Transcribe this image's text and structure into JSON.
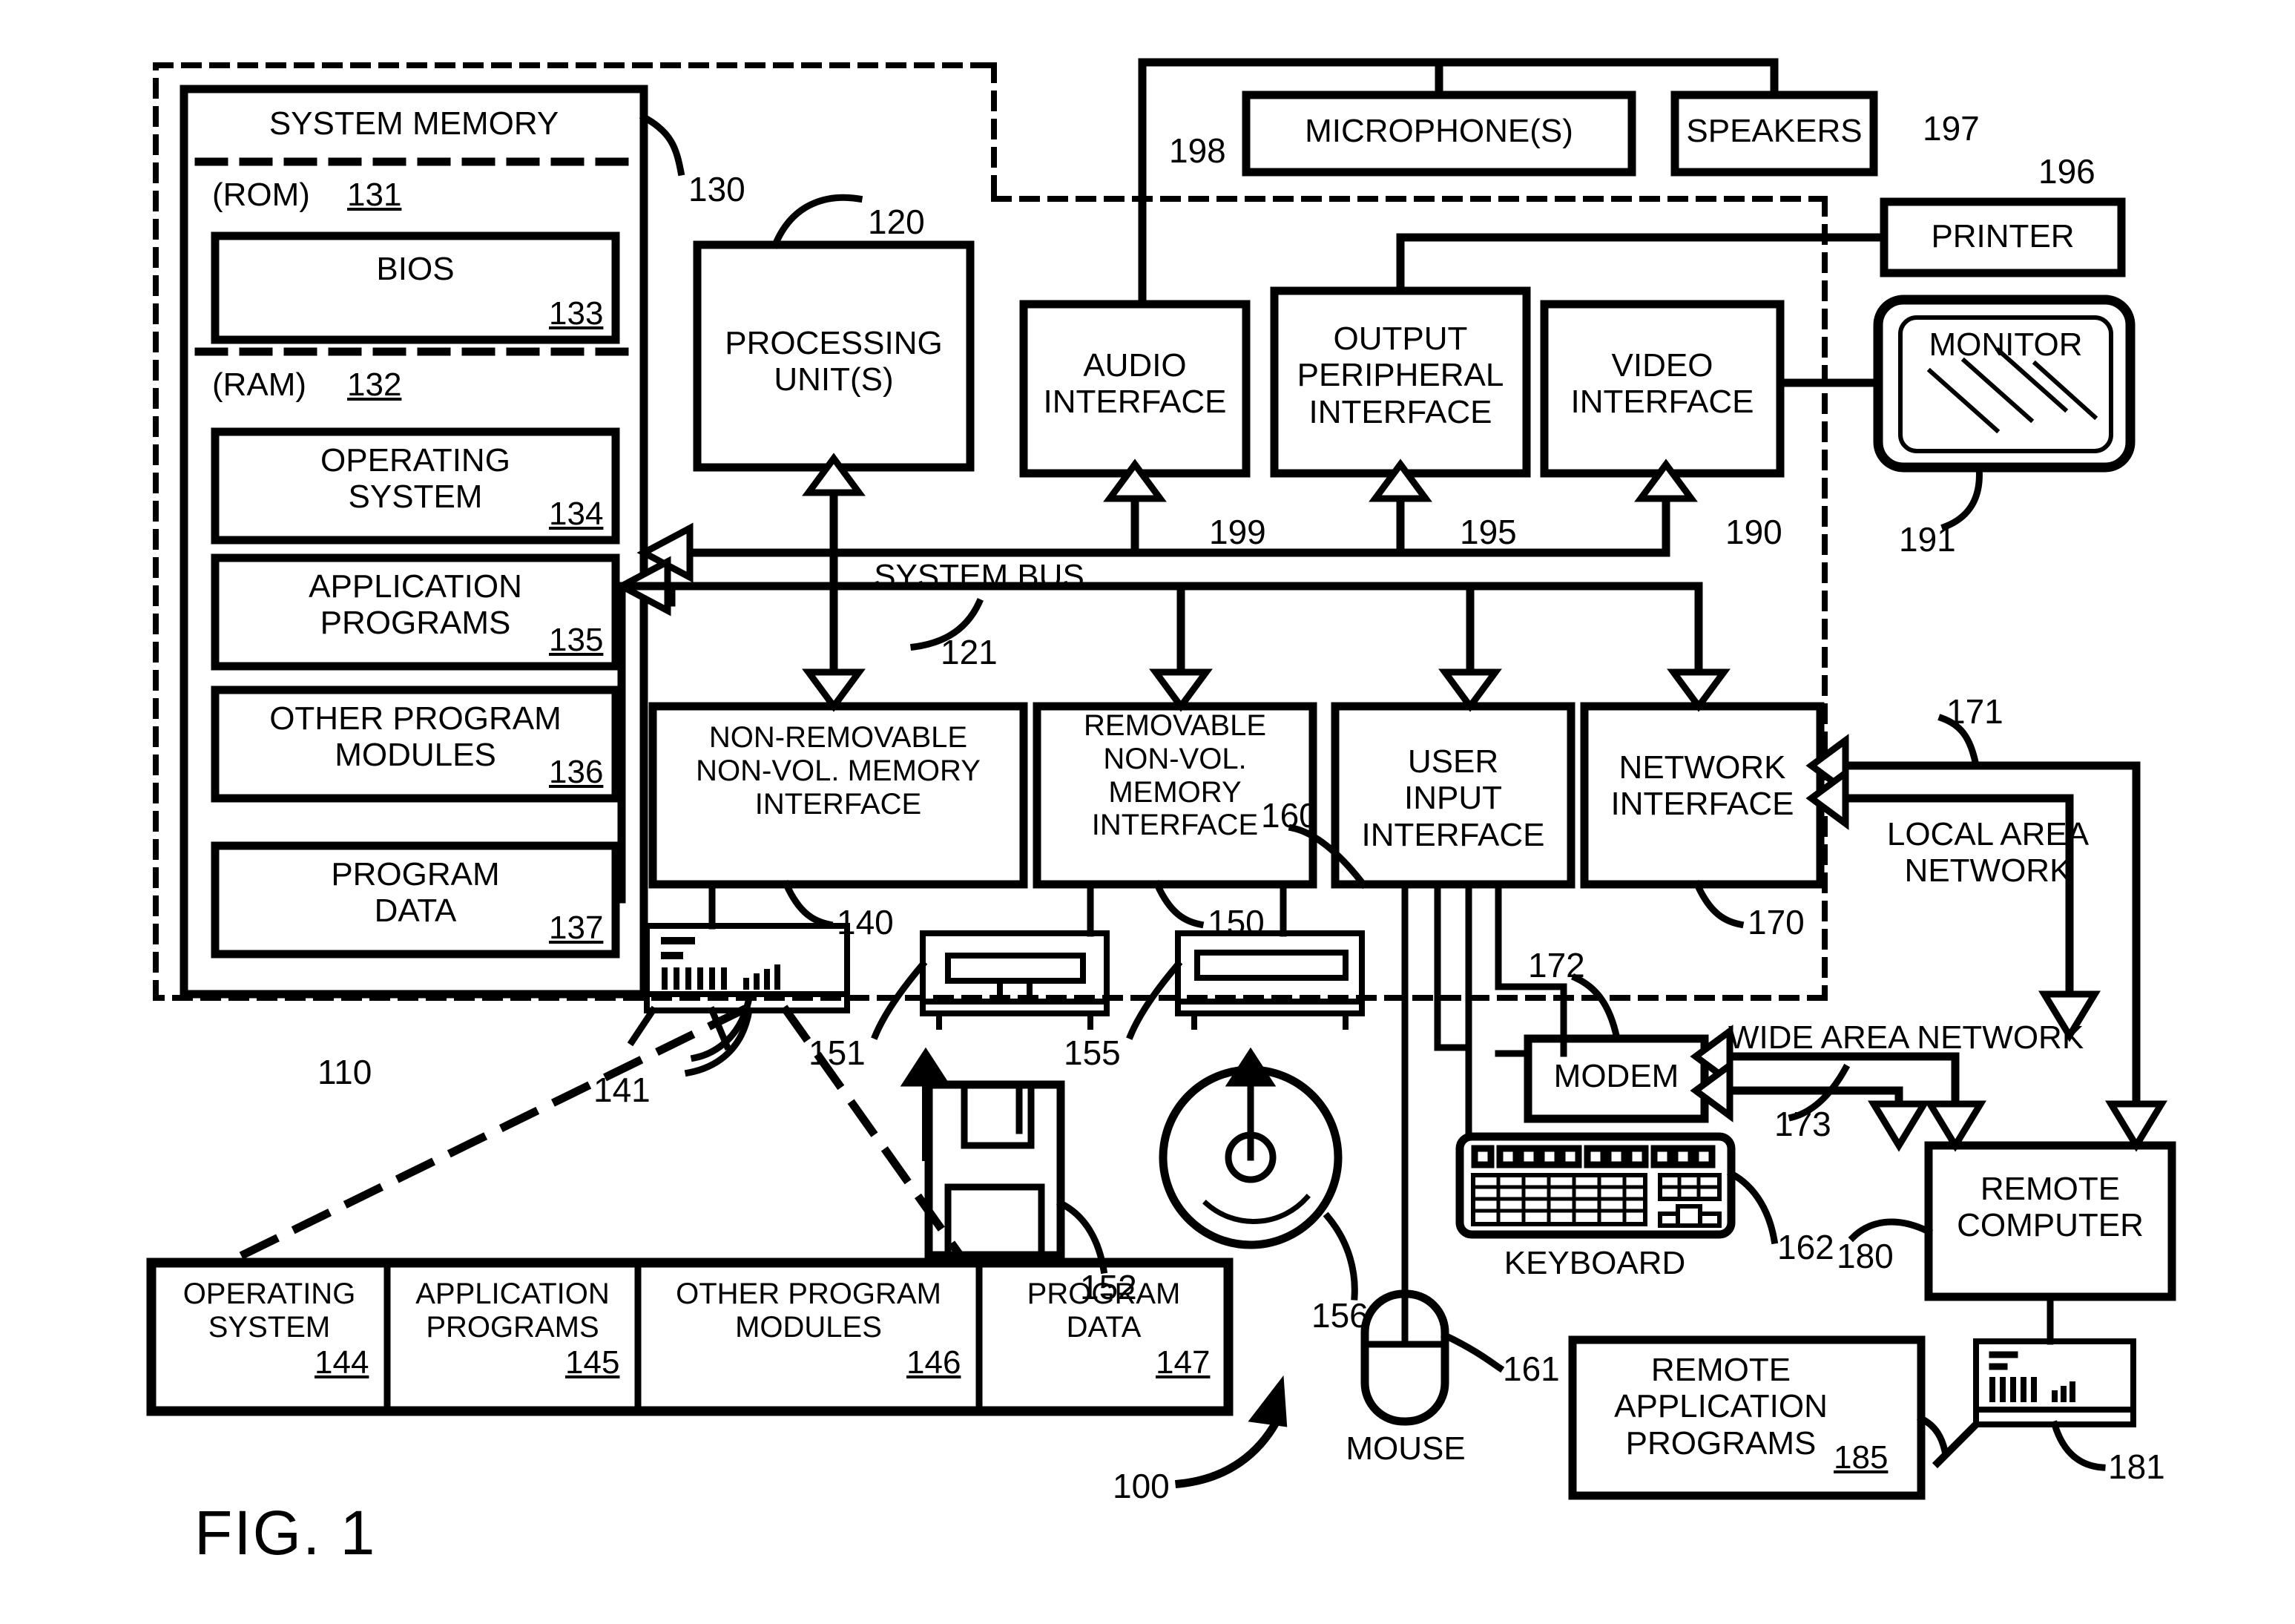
{
  "figure": {
    "caption": "FIG. 1",
    "system_ref": "100",
    "computer_ref": "110"
  },
  "system_memory": {
    "title": "SYSTEM MEMORY",
    "ref": "130",
    "rom_label": "(ROM)",
    "rom_ref": "131",
    "bios_label": "BIOS",
    "bios_ref": "133",
    "ram_label": "(RAM)",
    "ram_ref": "132",
    "ram_items": [
      {
        "label": "OPERATING\nSYSTEM",
        "ref": "134"
      },
      {
        "label": "APPLICATION\nPROGRAMS",
        "ref": "135"
      },
      {
        "label": "OTHER PROGRAM\nMODULES",
        "ref": "136"
      },
      {
        "label": "PROGRAM\nDATA",
        "ref": "137"
      }
    ]
  },
  "processing_unit": {
    "label": "PROCESSING\nUNIT(S)",
    "ref": "120"
  },
  "system_bus": {
    "label": "SYSTEM BUS",
    "ref": "121"
  },
  "top_peripherals": [
    {
      "label": "MICROPHONE(S)",
      "ref": "198"
    },
    {
      "label": "SPEAKERS",
      "ref": "197"
    },
    {
      "label": "PRINTER",
      "ref": "196"
    },
    {
      "label": "MONITOR",
      "ref": "191"
    }
  ],
  "upper_interfaces": [
    {
      "label": "AUDIO\nINTERFACE",
      "ref": "199"
    },
    {
      "label": "OUTPUT\nPERIPHERAL\nINTERFACE",
      "ref": "195"
    },
    {
      "label": "VIDEO\nINTERFACE",
      "ref": "190"
    }
  ],
  "lower_interfaces": [
    {
      "label": "NON-REMOVABLE\nNON-VOL. MEMORY\nINTERFACE",
      "ref": "140"
    },
    {
      "label": "REMOVABLE\nNON-VOL.\nMEMORY\nINTERFACE",
      "ref": "150"
    },
    {
      "label": "USER\nINPUT\nINTERFACE",
      "ref": "160"
    },
    {
      "label": "NETWORK\nINTERFACE",
      "ref": "170"
    }
  ],
  "storage_devices": [
    {
      "name": "hard-disk-drive",
      "ref": "141"
    },
    {
      "name": "floppy-disk-drive",
      "ref": "151"
    },
    {
      "name": "floppy-disk-media",
      "ref": "152"
    },
    {
      "name": "optical-disc-drive",
      "ref": "155"
    },
    {
      "name": "optical-disc-media",
      "ref": "156"
    }
  ],
  "disk_contents": [
    {
      "label": "OPERATING\nSYSTEM",
      "ref": "144"
    },
    {
      "label": "APPLICATION\nPROGRAMS",
      "ref": "145"
    },
    {
      "label": "OTHER PROGRAM\nMODULES",
      "ref": "146"
    },
    {
      "label": "PROGRAM\nDATA",
      "ref": "147"
    }
  ],
  "input_devices": [
    {
      "label": "KEYBOARD",
      "ref": "162"
    },
    {
      "label": "MOUSE",
      "ref": "161"
    }
  ],
  "network": {
    "lan_label": "LOCAL AREA\nNETWORK",
    "lan_ref": "171",
    "wan_label": "WIDE AREA NETWORK",
    "wan_ref": "173",
    "modem_label": "MODEM",
    "modem_ref": "172",
    "remote_computer_label": "REMOTE\nCOMPUTER",
    "remote_computer_ref": "180",
    "remote_storage_ref": "181",
    "remote_apps_label": "REMOTE\nAPPLICATION\nPROGRAMS",
    "remote_apps_ref": "185"
  },
  "colors": {
    "ink": "#000000",
    "paper": "#ffffff"
  }
}
